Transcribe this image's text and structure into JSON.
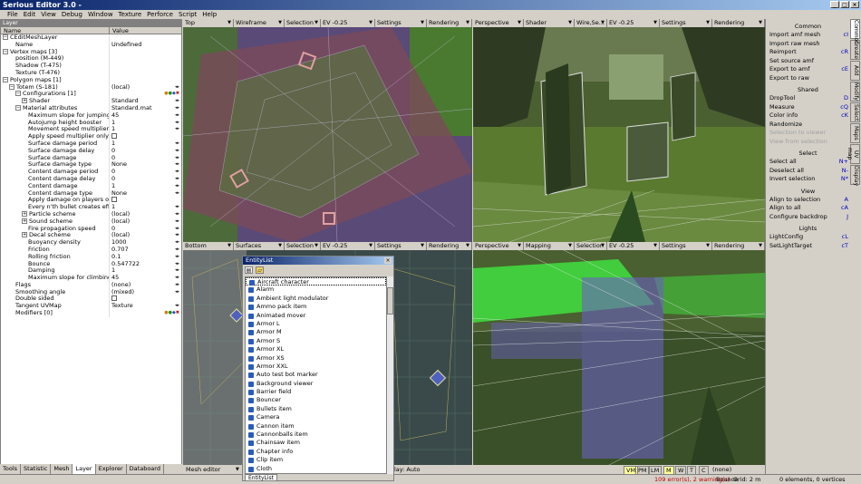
{
  "window": {
    "title": "Serious Editor 3.0 -"
  },
  "menu": [
    "File",
    "Edit",
    "View",
    "Debug",
    "Window",
    "Texture",
    "Perforce",
    "Script",
    "Help"
  ],
  "left_panel": {
    "title": "Layer",
    "col_name": "Name",
    "col_value": "Value",
    "rows": [
      {
        "name": "CEditMeshLayer",
        "value": "",
        "indent": 0,
        "exp": "-"
      },
      {
        "name": "Name",
        "value": "Undefined",
        "indent": 2,
        "exp": ""
      },
      {
        "name": "Vertex maps [3]",
        "value": "",
        "indent": 0,
        "exp": "-"
      },
      {
        "name": "position (M-449)",
        "value": "",
        "indent": 2,
        "exp": ""
      },
      {
        "name": "Shadow (T-475)",
        "value": "",
        "indent": 2,
        "exp": ""
      },
      {
        "name": "Texture (T-476)",
        "value": "",
        "indent": 2,
        "exp": ""
      },
      {
        "name": "Polygon maps [1]",
        "value": "",
        "indent": 0,
        "exp": "-"
      },
      {
        "name": "Totem (S-181)",
        "value": "(local)",
        "indent": 1,
        "exp": "-",
        "arr": true
      },
      {
        "name": "Configurations [1]",
        "value": "",
        "indent": 2,
        "exp": "-",
        "icons": true
      },
      {
        "name": "Shader",
        "value": "Standard",
        "indent": 3,
        "exp": "+",
        "arr": true
      },
      {
        "name": "Material attributes",
        "value": "Standard.mat",
        "indent": 2,
        "exp": "-",
        "arr": true
      },
      {
        "name": "Maximum slope for jumping",
        "value": "45",
        "indent": 4,
        "exp": "",
        "arr": true
      },
      {
        "name": "Autojump height booster",
        "value": "1",
        "indent": 4,
        "exp": "",
        "arr": true
      },
      {
        "name": "Movement speed multiplier",
        "value": "1",
        "indent": 4,
        "exp": "",
        "arr": true
      },
      {
        "name": "Apply speed multiplier only or",
        "value": "",
        "indent": 4,
        "exp": "",
        "chk": true
      },
      {
        "name": "Surface damage period",
        "value": "1",
        "indent": 4,
        "exp": "",
        "arr": true
      },
      {
        "name": "Surface damage delay",
        "value": "0",
        "indent": 4,
        "exp": "",
        "arr": true
      },
      {
        "name": "Surface damage",
        "value": "0",
        "indent": 4,
        "exp": "",
        "arr": true
      },
      {
        "name": "Surface damage type",
        "value": "None",
        "indent": 4,
        "exp": "",
        "arr": true
      },
      {
        "name": "Content damage period",
        "value": "0",
        "indent": 4,
        "exp": "",
        "arr": true
      },
      {
        "name": "Content damage delay",
        "value": "0",
        "indent": 4,
        "exp": "",
        "arr": true
      },
      {
        "name": "Content damage",
        "value": "1",
        "indent": 4,
        "exp": "",
        "arr": true
      },
      {
        "name": "Content damage type",
        "value": "None",
        "indent": 4,
        "exp": "",
        "arr": true
      },
      {
        "name": "Apply damage on players onl",
        "value": "",
        "indent": 4,
        "exp": "",
        "chk": true
      },
      {
        "name": "Every n'th bullet creates effe",
        "value": "1",
        "indent": 4,
        "exp": "",
        "arr": true
      },
      {
        "name": "Particle scheme",
        "value": "(local)",
        "indent": 3,
        "exp": "+",
        "arr": true
      },
      {
        "name": "Sound scheme",
        "value": "(local)",
        "indent": 3,
        "exp": "+",
        "arr": true
      },
      {
        "name": "Fire propagation speed",
        "value": "0",
        "indent": 4,
        "exp": "",
        "arr": true
      },
      {
        "name": "Decal scheme",
        "value": "(local)",
        "indent": 3,
        "exp": "+",
        "arr": true
      },
      {
        "name": "Buoyancy density",
        "value": "1000",
        "indent": 4,
        "exp": "",
        "arr": true
      },
      {
        "name": "Friction",
        "value": "0.707",
        "indent": 4,
        "exp": "",
        "arr": true
      },
      {
        "name": "Rolling friction",
        "value": "0.1",
        "indent": 4,
        "exp": "",
        "arr": true
      },
      {
        "name": "Bounce",
        "value": "0.547722",
        "indent": 4,
        "exp": "",
        "arr": true
      },
      {
        "name": "Damping",
        "value": "1",
        "indent": 4,
        "exp": "",
        "arr": true
      },
      {
        "name": "Maximum slope for climbing",
        "value": "45",
        "indent": 4,
        "exp": "",
        "arr": true
      },
      {
        "name": "Flags",
        "value": "(none)",
        "indent": 2,
        "exp": "",
        "arr": true
      },
      {
        "name": "Smoothing angle",
        "value": "(mixed)",
        "indent": 2,
        "exp": "",
        "arr": true
      },
      {
        "name": "Double sided",
        "value": "",
        "indent": 2,
        "exp": "",
        "chk": true
      },
      {
        "name": "Tangent UVMap",
        "value": "Texture",
        "indent": 2,
        "exp": "",
        "arr": true
      },
      {
        "name": "Modifiers [0]",
        "value": "",
        "indent": 2,
        "exp": "",
        "icons": true
      }
    ],
    "tabs": [
      "Tools",
      "Statistic",
      "Mesh",
      "Layer",
      "Explorer",
      "Databoard"
    ],
    "active_tab": "Layer"
  },
  "viewports": [
    {
      "id": "tl",
      "toolbar": [
        "Top",
        "Wireframe",
        "Selection",
        "EV -0.25",
        "Settings",
        "Rendering"
      ]
    },
    {
      "id": "tr",
      "toolbar": [
        "Perspective",
        "Shader",
        "Wire,Se...",
        "EV -0.25",
        "Settings",
        "Rendering"
      ]
    },
    {
      "id": "bl",
      "toolbar": [
        "Bottom",
        "Surfaces",
        "Selection",
        "EV -0.25",
        "Settings",
        "Rendering"
      ]
    },
    {
      "id": "br",
      "toolbar": [
        "Perspective",
        "Mapping",
        "Selection",
        "EV -0.25",
        "Settings",
        "Rendering"
      ]
    }
  ],
  "entity_list": {
    "title": "EntityList",
    "tab": "EntityList",
    "items": [
      "Aircraft character",
      "Alarm",
      "Ambient light modulator",
      "Ammo pack item",
      "Animated mover",
      "Armor L",
      "Armor M",
      "Armor S",
      "Armor XL",
      "Armor XS",
      "Armor XXL",
      "Auto test bot marker",
      "Background viewer",
      "Barrier field",
      "Bouncer",
      "Bullets item",
      "Camera",
      "Cannon item",
      "Cannonballs item",
      "Chainsaw item",
      "Chapter info",
      "Clip item",
      "Cloth"
    ]
  },
  "right_panel": {
    "sections": [
      {
        "head": "Common",
        "items": [
          {
            "label": "Import amf mesh",
            "sc": "cI"
          },
          {
            "label": "Import raw mesh",
            "sc": ""
          },
          {
            "label": "Reimport",
            "sc": "cR"
          },
          {
            "label": "Set source amf",
            "sc": ""
          },
          {
            "label": "Export to amf",
            "sc": "cE"
          },
          {
            "label": "Export to raw",
            "sc": ""
          }
        ]
      },
      {
        "head": "Shared",
        "items": [
          {
            "label": "DropTool",
            "sc": "D"
          },
          {
            "label": "Measure",
            "sc": "cQ"
          },
          {
            "label": "Color info",
            "sc": "cK"
          },
          {
            "label": "Randomize",
            "sc": ""
          },
          {
            "label": "Selection to viewer",
            "sc": "",
            "dis": true
          },
          {
            "label": "View from selection",
            "sc": "",
            "dis": true
          }
        ]
      },
      {
        "head": "Select",
        "items": [
          {
            "label": "Select all",
            "sc": "N+"
          },
          {
            "label": "Deselect all",
            "sc": "N-"
          },
          {
            "label": "Invert selection",
            "sc": "N*"
          }
        ]
      },
      {
        "head": "View",
        "items": [
          {
            "label": "Align to selection",
            "sc": "A"
          },
          {
            "label": "Align to all",
            "sc": "cA"
          },
          {
            "label": "Configure backdrop",
            "sc": "J"
          }
        ]
      },
      {
        "head": "Lights",
        "items": [
          {
            "label": "LightConfig",
            "sc": "cL"
          },
          {
            "label": "SetLightTarget",
            "sc": "cT"
          }
        ]
      }
    ],
    "vtabs": [
      "Common",
      "Create",
      "Add",
      "Modify",
      "Select",
      "Maps",
      "UV map",
      "Display"
    ],
    "active_vtab": "Common"
  },
  "bottom_toolbar": {
    "mode": "Mesh editor",
    "play": "lay: Auto",
    "buttons": [
      "VM",
      "PM",
      "LM",
      "M",
      "W",
      "T",
      "C"
    ],
    "filter": "(none)"
  },
  "status": {
    "errors": "109 error(s), 2 warning(s)",
    "bounce": "Bounce",
    "grid": "Grid: 2 m",
    "elements": "0 elements, 0 vertices"
  },
  "colors": {
    "titlebar": "#0a246a",
    "selection": "#0a246a",
    "shortcut": "#0000c0",
    "error": "#c00000"
  }
}
